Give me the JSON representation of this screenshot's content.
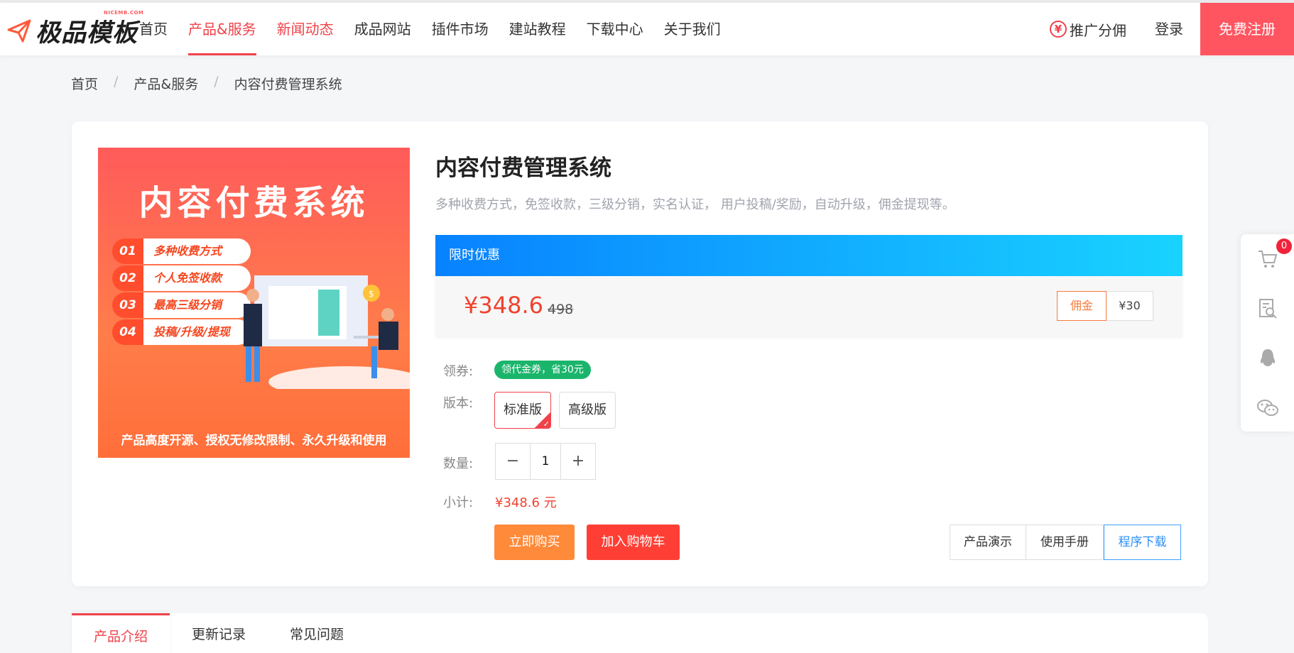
{
  "header": {
    "logo_text": "极品模板",
    "logo_sub": "NICEMB.COM",
    "nav": [
      {
        "label": "首页"
      },
      {
        "label": "产品&服务"
      },
      {
        "label": "新闻动态"
      },
      {
        "label": "成品网站"
      },
      {
        "label": "插件市场"
      },
      {
        "label": "建站教程"
      },
      {
        "label": "下载中心"
      },
      {
        "label": "关于我们"
      }
    ],
    "promo_icon": "¥",
    "promo_label": "推广分佣",
    "login_label": "登录",
    "register_label": "免费注册"
  },
  "breadcrumb": [
    "首页",
    "产品&服务",
    "内容付费管理系统"
  ],
  "product": {
    "banner": {
      "title": "内容付费系统",
      "features": [
        {
          "num": "01",
          "label": "多种收费方式"
        },
        {
          "num": "02",
          "label": "个人免签收款"
        },
        {
          "num": "03",
          "label": "最高三级分销"
        },
        {
          "num": "04",
          "label": "投稿/升级/提现"
        }
      ],
      "footer": "产品高度开源、授权无修改限制、永久升级和使用"
    },
    "title": "内容付费管理系统",
    "description": "多种收费方式，免签收款，三级分销，实名认证， 用户投稿/奖励，自动升级，佣金提现等。",
    "offer_label": "限时优惠",
    "price": "¥348.6",
    "original_price": "498",
    "commission_label": "佣金",
    "commission_value": "¥30",
    "coupon_label": "领券:",
    "coupon_text": "领代金券，省30元",
    "version_label": "版本:",
    "versions": [
      {
        "label": "标准版",
        "selected": true
      },
      {
        "label": "高级版",
        "selected": false
      }
    ],
    "quantity_label": "数量:",
    "quantity_minus": "−",
    "quantity": "1",
    "quantity_plus": "+",
    "subtotal_label": "小计:",
    "subtotal_value": "¥348.6 元",
    "buy_label": "立即购买",
    "cart_label": "加入购物车",
    "links": [
      "产品演示",
      "使用手册",
      "程序下载"
    ]
  },
  "tabs": [
    "产品介绍",
    "更新记录",
    "常见问题"
  ],
  "sidebar": {
    "cart_count": "0",
    "icons": [
      "cart-icon",
      "search-doc-icon",
      "qq-icon",
      "wechat-icon"
    ]
  },
  "colors": {
    "brand_red": "#f0424a",
    "price_red": "#f0422e",
    "offer_blue": "#0882ff",
    "buy_orange": "#ff8a3a",
    "coupon_green": "#1ab56b"
  }
}
